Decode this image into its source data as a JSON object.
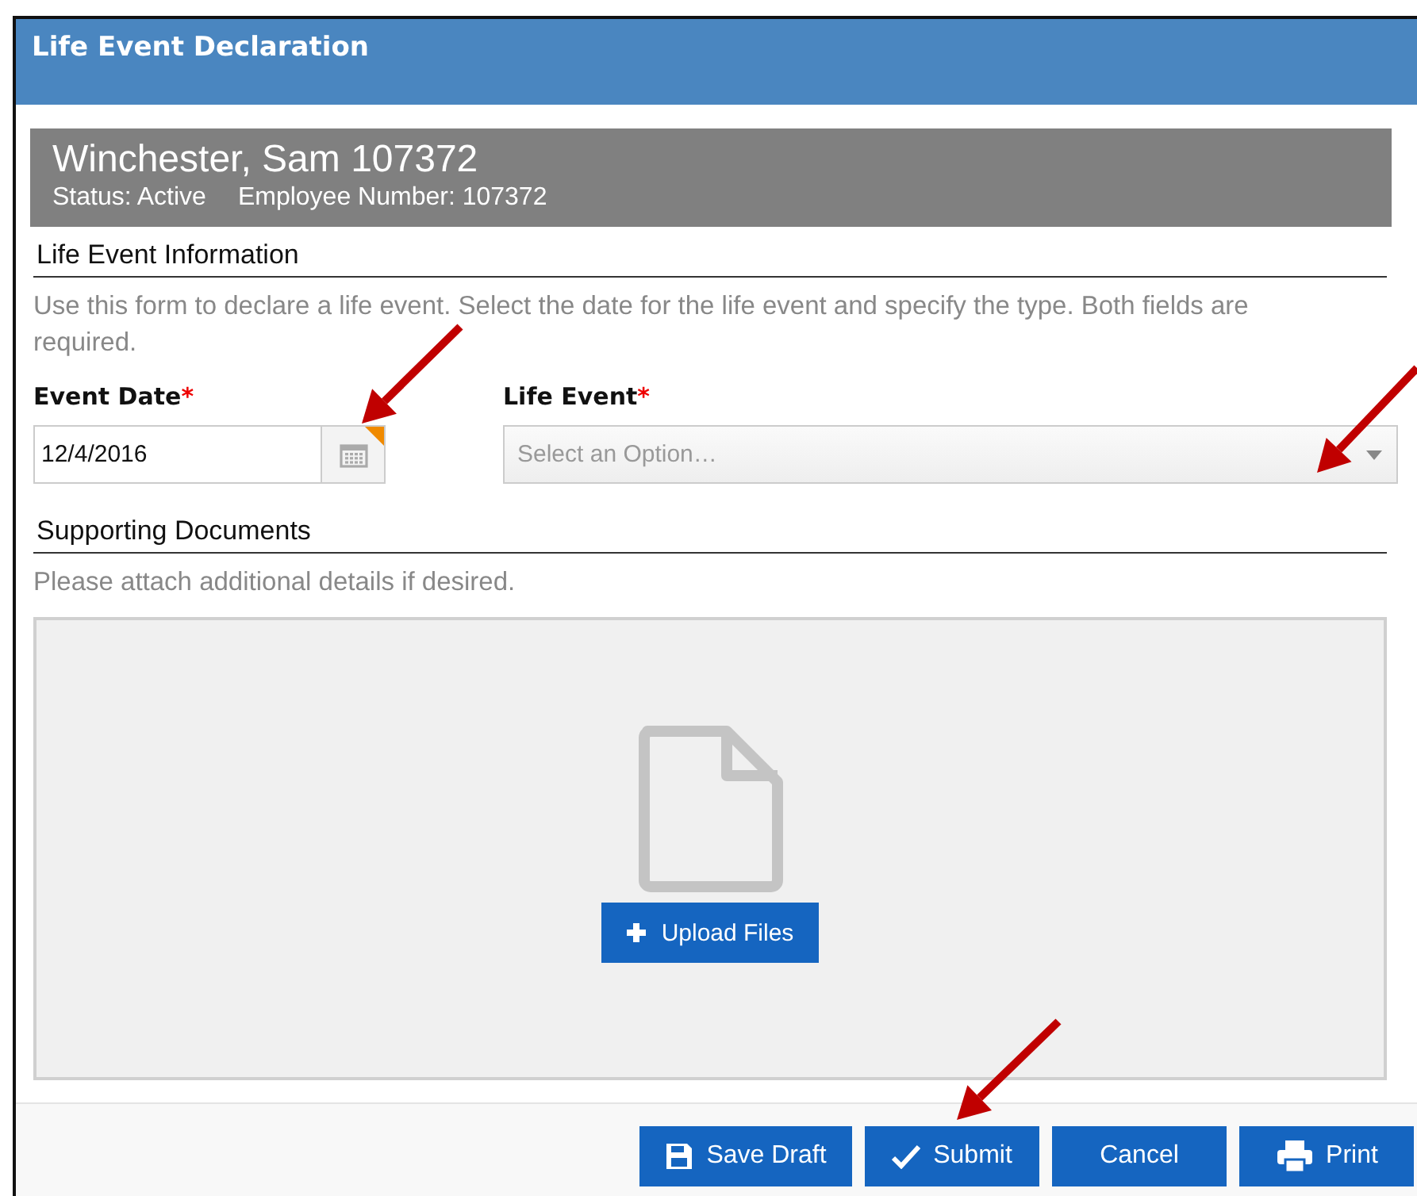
{
  "window": {
    "title": "Life Event Declaration"
  },
  "employee": {
    "name": "Winchester, Sam 107372",
    "status": "Status: Active",
    "employee_number": "Employee Number: 107372"
  },
  "info_section": {
    "heading": "Life Event Information",
    "description": "Use this form to declare a life event. Select the date for the life event and specify the type. Both fields are required."
  },
  "fields": [
    {
      "kind": "date",
      "label": "Event Date",
      "required_mark": "*",
      "value": "12/4/2016"
    },
    {
      "kind": "select",
      "label": "Life Event",
      "required_mark": "*",
      "placeholder": "Select an Option…"
    }
  ],
  "documents_section": {
    "heading": "Supporting Documents",
    "description": "Please attach additional details if desired.",
    "upload_button": "Upload Files"
  },
  "buttons": [
    {
      "kind": "save",
      "label": "Save Draft"
    },
    {
      "kind": "submit",
      "label": "Submit"
    },
    {
      "kind": "cancel",
      "label": "Cancel"
    },
    {
      "kind": "print",
      "label": "Print"
    }
  ]
}
